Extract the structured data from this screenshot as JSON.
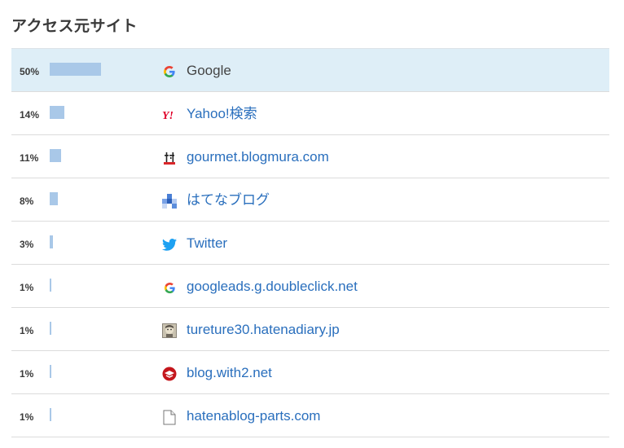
{
  "title": "アクセス元サイト",
  "accent_color": "#a9c8e8",
  "link_color": "#2a6fbd",
  "rows": [
    {
      "percent": "50%",
      "value": 0.5,
      "site": "Google",
      "icon": "google-icon"
    },
    {
      "percent": "14%",
      "value": 0.14,
      "site": "Yahoo!検索",
      "icon": "yahoo-icon"
    },
    {
      "percent": "11%",
      "value": 0.11,
      "site": "gourmet.blogmura.com",
      "icon": "blogmura-icon"
    },
    {
      "percent": "8%",
      "value": 0.08,
      "site": "はてなブログ",
      "icon": "hatena-blog-icon"
    },
    {
      "percent": "3%",
      "value": 0.03,
      "site": "Twitter",
      "icon": "twitter-icon"
    },
    {
      "percent": "1%",
      "value": 0.01,
      "site": "googleads.g.doubleclick.net",
      "icon": "google-icon"
    },
    {
      "percent": "1%",
      "value": 0.01,
      "site": "tureture30.hatenadiary.jp",
      "icon": "user-avatar-icon"
    },
    {
      "percent": "1%",
      "value": 0.01,
      "site": "blog.with2.net",
      "icon": "with2-icon"
    },
    {
      "percent": "1%",
      "value": 0.01,
      "site": "hatenablog-parts.com",
      "icon": "document-icon"
    }
  ]
}
